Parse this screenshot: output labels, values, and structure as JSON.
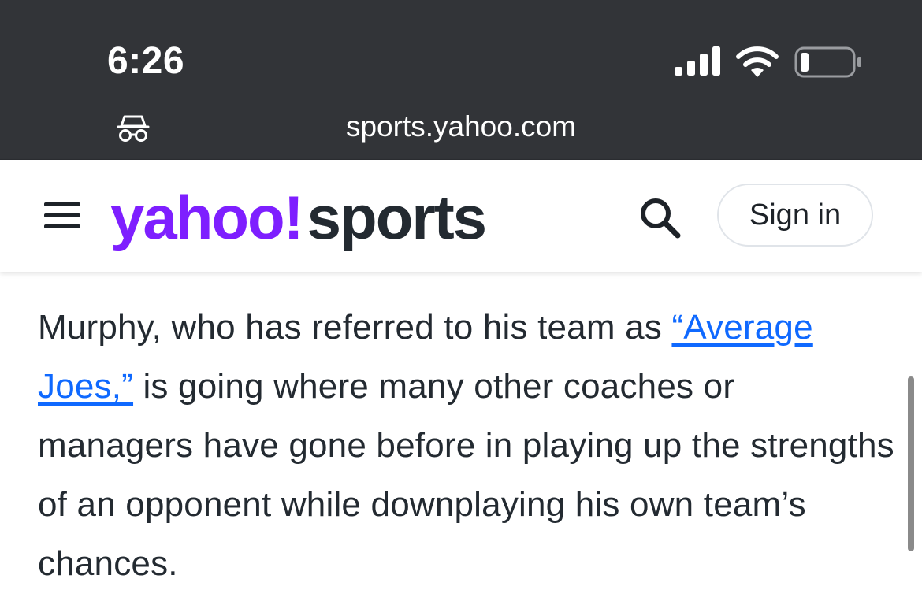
{
  "status_bar": {
    "time": "6:26",
    "signal_icon": "cellular-signal-icon",
    "wifi_icon": "wifi-icon",
    "battery_icon": "battery-low-icon",
    "battery_level": 0.12
  },
  "browser": {
    "url": "sports.yahoo.com",
    "private_icon": "incognito-icon"
  },
  "header": {
    "menu_icon": "hamburger-menu-icon",
    "logo_yahoo": "yahoo!",
    "logo_sports": "sports",
    "logo_color": "#7e1fff",
    "search_icon": "search-icon",
    "sign_in_label": "Sign in"
  },
  "article": {
    "text_before_link": "Murphy, who has referred to his team as ",
    "link_text": "“Average Joes,”",
    "text_after_link": " is going where many other coaches or managers have gone before in playing up the strengths of an opponent while downplaying his own team’s chances.",
    "link_color": "#0f69ff",
    "text_color": "#232a31"
  }
}
